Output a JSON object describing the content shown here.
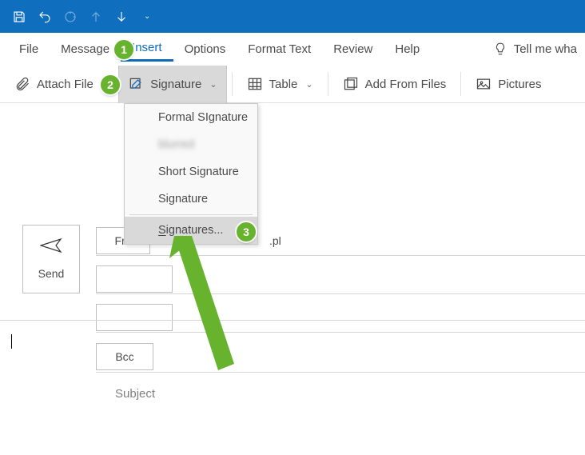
{
  "titlebar": {
    "icons": [
      "save",
      "undo",
      "redo",
      "up",
      "down"
    ]
  },
  "menu": {
    "file": "File",
    "message": "Message",
    "insert": "Insert",
    "options": "Options",
    "format_text": "Format Text",
    "review": "Review",
    "help": "Help",
    "tell_me": "Tell me wha"
  },
  "ribbon": {
    "attach": "Attach File",
    "signature": "Signature",
    "table": "Table",
    "add_from_files": "Add From Files",
    "pictures": "Pictures"
  },
  "compose": {
    "send": "Send",
    "from": "Fro",
    "from_trail": ".pl",
    "bcc": "Bcc",
    "subject": "Subject"
  },
  "dropdown": {
    "formal": "Formal SIgnature",
    "blur": "blurred",
    "short": "Short Signature",
    "signature": "Signature",
    "signatures": "ignatures..."
  },
  "callouts": {
    "c1": "1",
    "c2": "2",
    "c3": "3"
  }
}
